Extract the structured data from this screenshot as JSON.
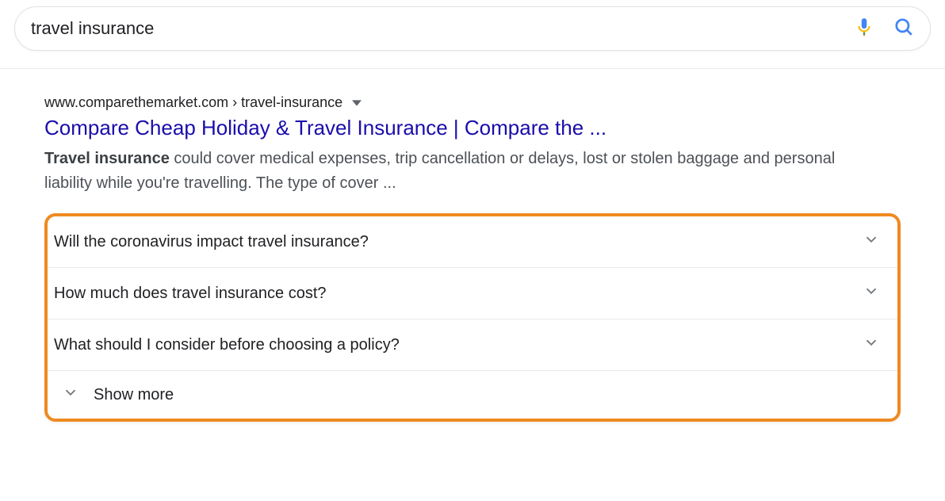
{
  "search": {
    "query": "travel insurance"
  },
  "result": {
    "url": "www.comparethemarket.com › travel-insurance",
    "title": "Compare Cheap Holiday & Travel Insurance | Compare the ...",
    "snippet_bold": "Travel insurance",
    "snippet_rest": " could cover medical expenses, trip cancellation or delays, lost or stolen baggage and personal liability while you're travelling. The type of cover ..."
  },
  "faq": {
    "items": [
      {
        "question": "Will the coronavirus impact travel insurance?"
      },
      {
        "question": "How much does travel insurance cost?"
      },
      {
        "question": "What should I consider before choosing a policy?"
      }
    ],
    "show_more": "Show more"
  },
  "highlight_color": "#ef8a21"
}
